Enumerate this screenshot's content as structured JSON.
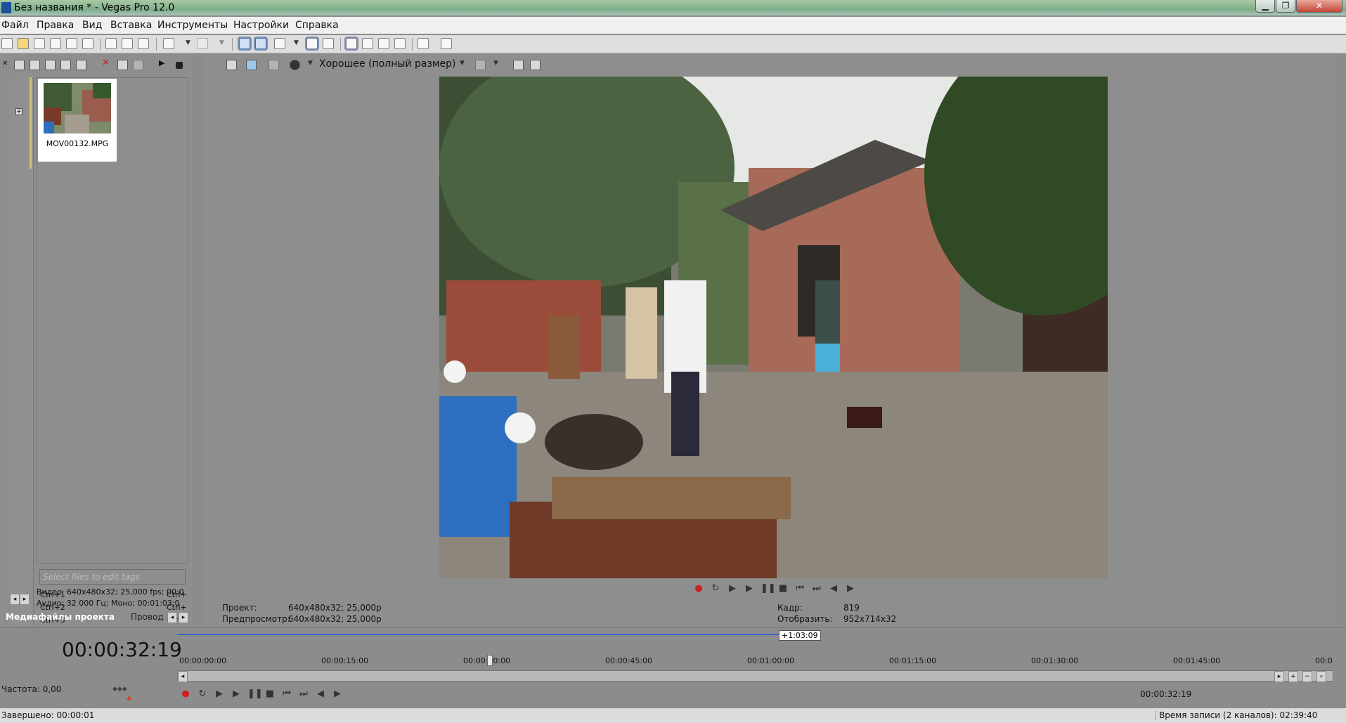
{
  "window": {
    "title": "Без названия * - Vegas Pro 12.0",
    "minimize": "▁",
    "maximize": "❐",
    "close": "✕"
  },
  "menu": [
    "Файл",
    "Правка",
    "Вид",
    "Вставка",
    "Инструменты",
    "Настройки",
    "Справка"
  ],
  "media_panel": {
    "file_name": "MOV00132.MPG",
    "tag_placeholder": "Select files to edit tags",
    "shortcuts": [
      {
        "key": "Ctrl+1",
        "right": "Ctrl+"
      },
      {
        "key": "Ctrl+2",
        "right": "Ctrl+"
      },
      {
        "key": "Ctrl+3",
        "right": "Ctrl+"
      }
    ],
    "video_info": "Видео: 640x480x32; 25,000 fps; 00:0",
    "audio_info": "Аудио: 32 000 Гц; Моно; 00:01:03:0",
    "tabs": {
      "media": "Медиафайлы проекта",
      "explorer": "Провод"
    }
  },
  "preview": {
    "quality": "Хорошее (полный размер)",
    "project_label": "Проект:",
    "project_value": "640x480x32; 25,000p",
    "preview_label": "Предпросмотр:",
    "preview_value": "640x480x32; 25,000p",
    "frame_label": "Кадр:",
    "frame_value": "819",
    "display_label": "Отобразить:",
    "display_value": "952x714x32"
  },
  "timeline": {
    "timecode": "00:00:32:19",
    "loop_label": "+1:03:09",
    "ruler": [
      "00:00:00:00",
      "00:00:15:00",
      "00:00:30:00",
      "00:00:45:00",
      "00:01:00:00",
      "00:01:15:00",
      "00:01:30:00",
      "00:01:45:00",
      "00:0"
    ],
    "rate": "Частота: 0,00",
    "cursor_time": "00:00:32:19"
  },
  "status": {
    "left": "Завершено: 00:00:01",
    "right": "Время записи (2 каналов): 02:39:40"
  },
  "colors": {
    "panel_bg": "#8e8e8e",
    "loop_bar": "#3a64c8",
    "record": "#cc2222"
  }
}
